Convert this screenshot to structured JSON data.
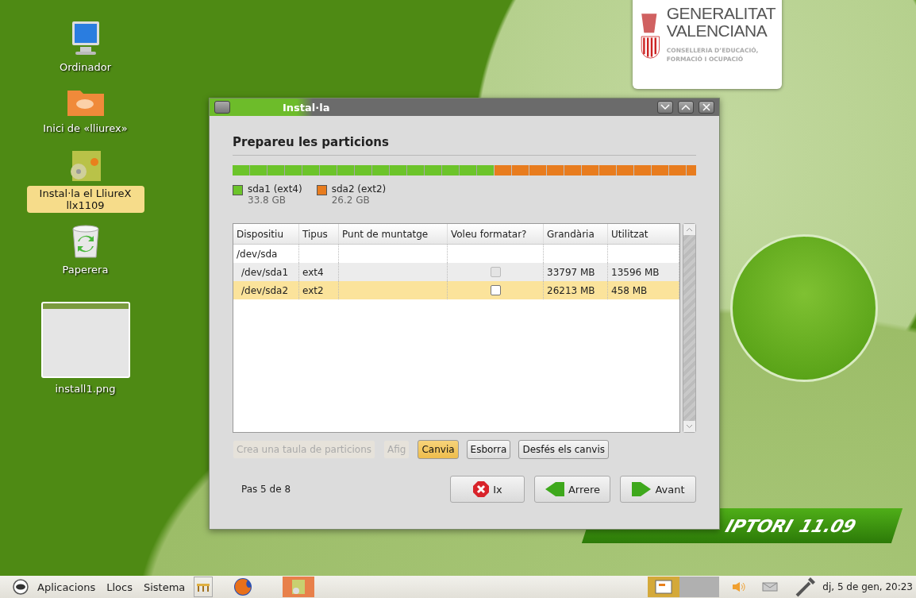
{
  "desktop_icons": [
    {
      "kind": "computer",
      "label": "Ordinador",
      "selected": false
    },
    {
      "kind": "folder",
      "label": "Inici de «lliurex»",
      "selected": false
    },
    {
      "kind": "installer",
      "label": "Instal·la el LliureX llx1109",
      "selected": true
    },
    {
      "kind": "trash",
      "label": "Paperera",
      "selected": false
    },
    {
      "kind": "image",
      "label": "install1.png",
      "selected": false
    }
  ],
  "logo": {
    "line_1": "GENERALITAT",
    "line_2": "VALENCIANA",
    "line_3": "CONSELLERIA D’EDUCACIÓ,",
    "line_4": "FORMACIÓ I OCUPACIÓ"
  },
  "banner": {
    "text": "IPTORI",
    "version": "11.09"
  },
  "window": {
    "title": "Instal·la",
    "heading": "Prepareu les particions",
    "partitions": [
      {
        "name": "sda1 (ext4)",
        "size": "33.8 GB",
        "level": 0.563,
        "color": "#6cc42a"
      },
      {
        "name": "sda2 (ext2)",
        "size": "26.2 GB",
        "color": "#e87c1e"
      }
    ],
    "table": {
      "columns": [
        "Dispositiu",
        "Tipus",
        "Punt de muntatge",
        "Voleu formatar?",
        "Grandària",
        "Utilitzat"
      ],
      "rows": [
        {
          "device": "/dev/sda",
          "selected": false,
          "children": [
            {
              "device": "/dev/sda1",
              "type": "ext4",
              "format": {
                "checked": false,
                "disabled": true
              },
              "size": "33797 MB",
              "used": "13596 MB",
              "selected": false
            },
            {
              "device": "/dev/sda2",
              "type": "ext2",
              "format": {
                "checked": false,
                "disabled": false
              },
              "size": "26213 MB",
              "used": "458 MB",
              "selected": true
            }
          ]
        }
      ]
    },
    "actions": [
      {
        "label": "Crea una taula de particions",
        "disabled": true,
        "highlighted": false
      },
      {
        "label": "Afig",
        "disabled": true,
        "highlighted": false
      },
      {
        "label": "Canvia",
        "disabled": false,
        "highlighted": true
      },
      {
        "label": "Esborra",
        "disabled": false,
        "highlighted": false
      },
      {
        "label": "Desfés els canvis",
        "disabled": false,
        "highlighted": false
      }
    ],
    "step": "Pas 5 de 8",
    "nav_buttons": [
      {
        "kind": "quit",
        "label": "Ix"
      },
      {
        "kind": "back",
        "label": "Arrere"
      },
      {
        "kind": "forward",
        "label": "Avant"
      }
    ]
  },
  "taskbar": {
    "menus": [
      "Aplicacions",
      "Llocs",
      "Sistema"
    ],
    "clock": "dj, 5 de gen, 20:23"
  }
}
